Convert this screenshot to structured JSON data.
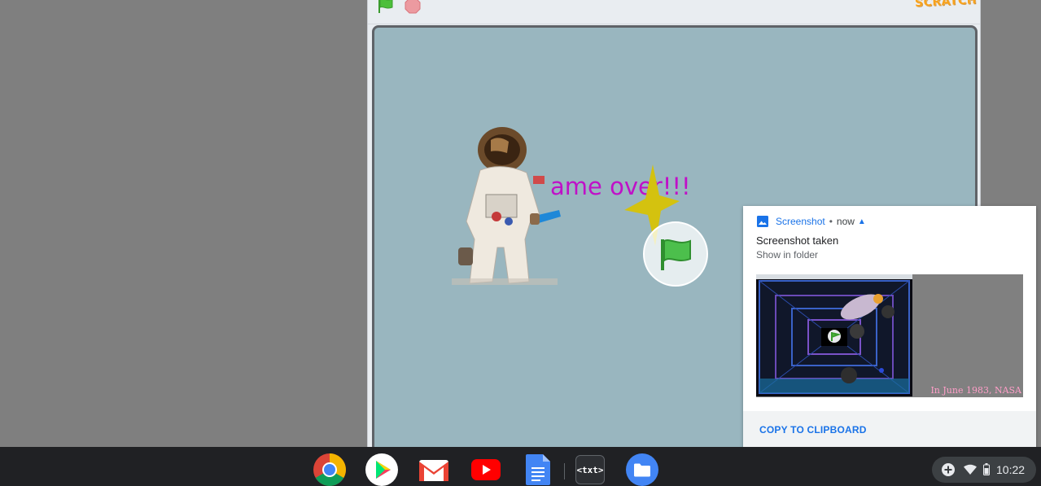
{
  "player": {
    "logo_text": "SCRATCH"
  },
  "stage": {
    "game_over_text": "ame over!!!"
  },
  "notification": {
    "app_name": "Screenshot",
    "separator": "•",
    "time": "now",
    "title": "Screenshot taken",
    "message": "Show in folder",
    "preview_caption": "In June 1983, NASA",
    "action_label": "COPY TO CLIPBOARD",
    "icons": [
      "image-icon",
      "chevron-up-icon"
    ]
  },
  "shelf": {
    "apps": [
      {
        "name": "Chrome",
        "icon": "chrome-icon"
      },
      {
        "name": "Play Store",
        "icon": "play-store-icon"
      },
      {
        "name": "Gmail",
        "icon": "gmail-icon"
      },
      {
        "name": "YouTube",
        "icon": "youtube-icon"
      },
      {
        "name": "Docs",
        "icon": "docs-icon"
      },
      {
        "name": "Text",
        "icon": "text-app-icon",
        "label": "<txt>"
      },
      {
        "name": "Files",
        "icon": "files-icon"
      }
    ]
  },
  "tray": {
    "time": "10:22",
    "icons": [
      "add-icon",
      "wifi-icon",
      "battery-icon"
    ]
  },
  "colors": {
    "stage_bg": "#99b6bf",
    "game_over_text": "#c010c8",
    "star": "#d4c20f",
    "accent_blue": "#1a73e8",
    "shelf_bg": "#202124"
  }
}
